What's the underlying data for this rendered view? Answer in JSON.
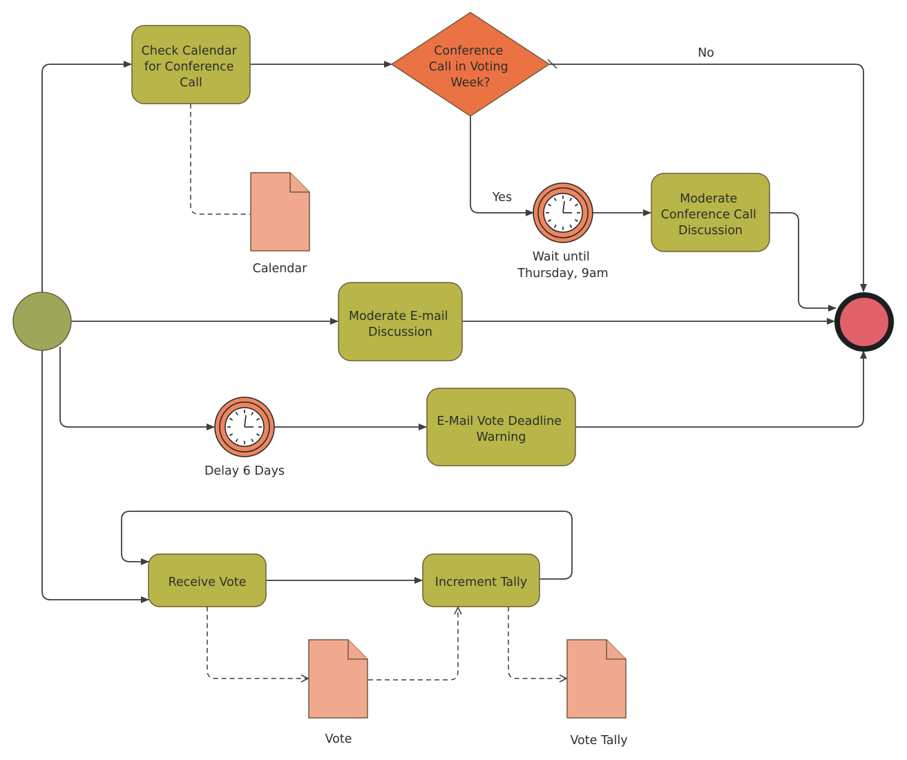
{
  "diagram": {
    "type": "BPMN process diagram",
    "colors": {
      "task_fill": "#b8b648",
      "gateway_fill": "#eb7343",
      "start_event_fill": "#9ca75a",
      "end_event_fill": "#e0616a",
      "end_event_border": "#1e1e1e",
      "timer_fill": "#eb8660",
      "data_object_fill": "#f0a98f",
      "connector": "#3d3d42"
    },
    "events": {
      "start": {
        "label": ""
      },
      "end": {
        "label": ""
      }
    },
    "tasks": {
      "check_calendar": {
        "lines": [
          "Check Calendar",
          "for Conference",
          "Call"
        ]
      },
      "moderate_conf_call": {
        "lines": [
          "Moderate",
          "Conference Call",
          "Discussion"
        ]
      },
      "moderate_email": {
        "lines": [
          "Moderate E-mail",
          "Discussion"
        ]
      },
      "email_vote_warning": {
        "lines": [
          "E-Mail Vote Deadline",
          "Warning"
        ]
      },
      "receive_vote": {
        "lines": [
          "Receive Vote"
        ]
      },
      "increment_tally": {
        "lines": [
          "Increment Tally"
        ]
      }
    },
    "gateway": {
      "lines": [
        "Conference",
        "Call in Voting",
        "Week?"
      ]
    },
    "flow_labels": {
      "no": "No",
      "yes": "Yes"
    },
    "timers": {
      "wait_thursday": {
        "lines": [
          "Wait until",
          "Thursday, 9am"
        ]
      },
      "delay_6_days": {
        "lines": [
          "Delay 6 Days"
        ]
      }
    },
    "data_objects": {
      "calendar": {
        "label": "Calendar"
      },
      "vote": {
        "label": "Vote"
      },
      "vote_tally": {
        "label": "Vote Tally"
      }
    }
  }
}
